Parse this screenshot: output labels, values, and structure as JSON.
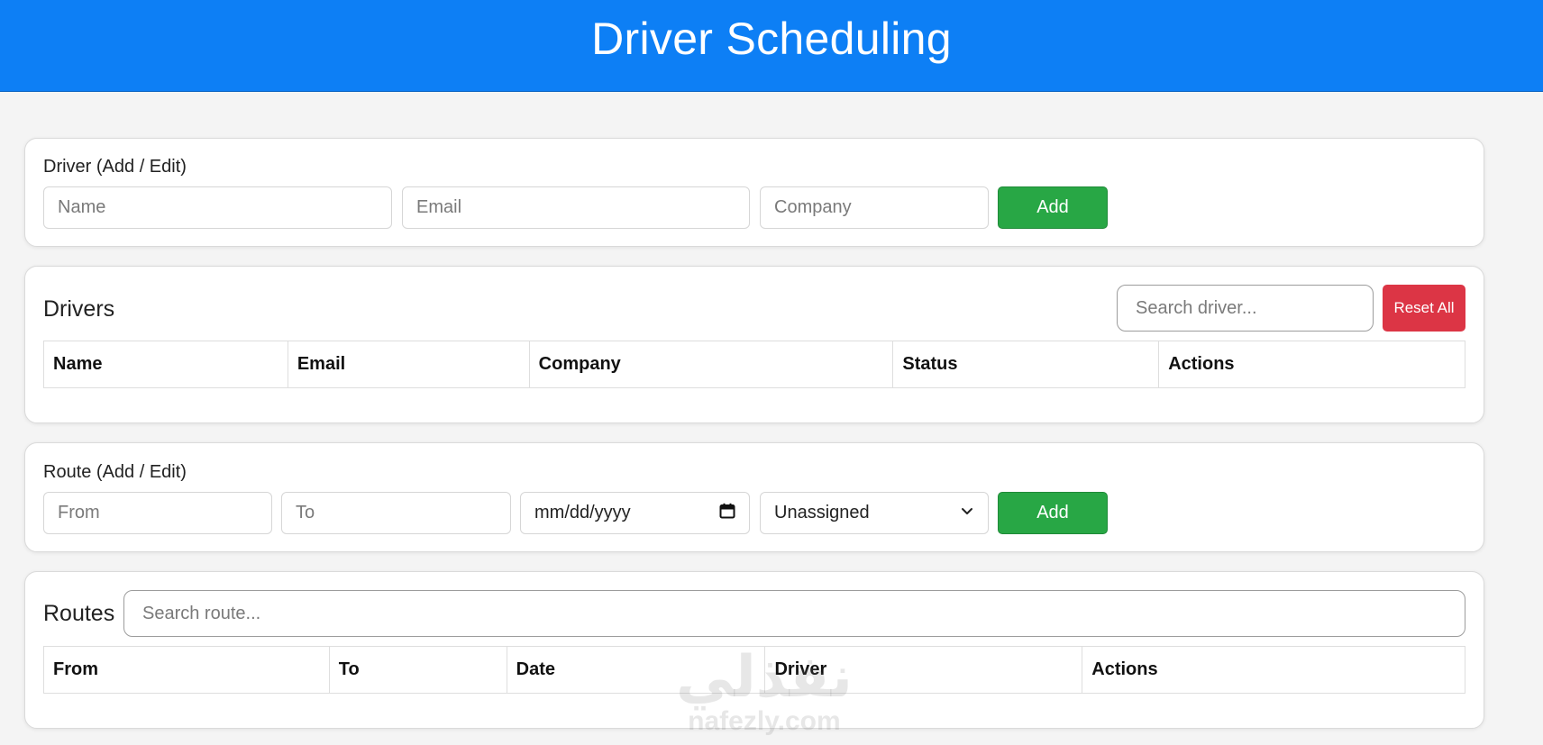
{
  "header": {
    "title": "Driver Scheduling"
  },
  "driver_form": {
    "label": "Driver (Add / Edit)",
    "name_placeholder": "Name",
    "email_placeholder": "Email",
    "company_placeholder": "Company",
    "add_label": "Add"
  },
  "drivers": {
    "title": "Drivers",
    "search_placeholder": "Search driver...",
    "reset_label": "Reset All",
    "columns": [
      "Name",
      "Email",
      "Company",
      "Status",
      "Actions"
    ]
  },
  "route_form": {
    "label": "Route (Add / Edit)",
    "from_placeholder": "From",
    "to_placeholder": "To",
    "date_placeholder": "mm/dd/yyyy",
    "driver_select_value": "Unassigned",
    "add_label": "Add"
  },
  "routes": {
    "title": "Routes",
    "search_placeholder": "Search route...",
    "columns": [
      "From",
      "To",
      "Date",
      "Driver",
      "Actions"
    ]
  },
  "watermark": {
    "arabic": "نفذلي",
    "latin": "nafezly.com"
  },
  "colors": {
    "header": "#0d7ff5",
    "add_button": "#28a745",
    "reset_button": "#dc3545"
  },
  "icons": {
    "date": "calendar-icon",
    "select": "chevron-down-icon"
  }
}
